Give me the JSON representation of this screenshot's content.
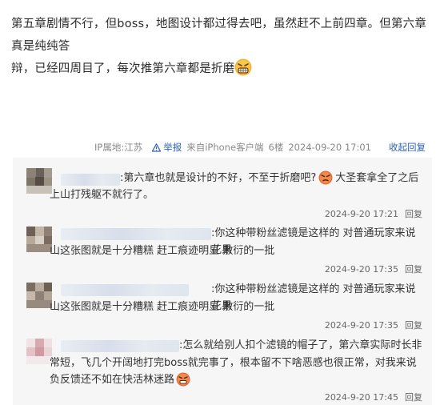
{
  "post": {
    "line1": "第五章剧情不行，但boss，地图设计都过得去吧，虽然赶不上前四章。但第六章真是纯纯答",
    "line2": "辩，已经四周目了，每次推第六章都是折磨",
    "emoji": "grimace-emoji"
  },
  "post_meta": {
    "ip": "IP属地:江苏",
    "report": "举报",
    "source": "来自iPhone客户端",
    "floor": "6楼",
    "time": "2024-09-20 17:01",
    "collapse": "收起回复"
  },
  "replies": [
    {
      "text1": ":第六章也就是设计的不好，不至于折磨吧?",
      "text1b": "大圣套拿全了之后",
      "text2": "上山打残躯不就行了。",
      "time": "2024-9-20 17:21",
      "reply_label": "回复"
    },
    {
      "text1": ":你这种带粉丝滤镜是这样的 对普通玩家来说花果",
      "text2": "山这张图就是十分糟糕 赶工痕迹明显 敷衍的一批",
      "time": "2024-9-20 17:35",
      "reply_label": "回复"
    },
    {
      "text1": ":你这种带粉丝滤镜是这样的 对普通玩家来说花果",
      "text2": "山这张图就是十分糟糕 赶工痕迹明显 敷衍的一批",
      "time": "2024-9-20 17:35",
      "reply_label": "回复"
    },
    {
      "text1": ":怎么就给别人扣个滤镜的帽子了，第六章实际时长非",
      "text2": "常短，飞几个开阔地打完boss就完事了，根本留不下啥恶感也很正常，对我来说",
      "text3": "负反馈还不如在快活林迷路",
      "time": "2024-9-20 17:45",
      "reply_label": "回复"
    }
  ]
}
